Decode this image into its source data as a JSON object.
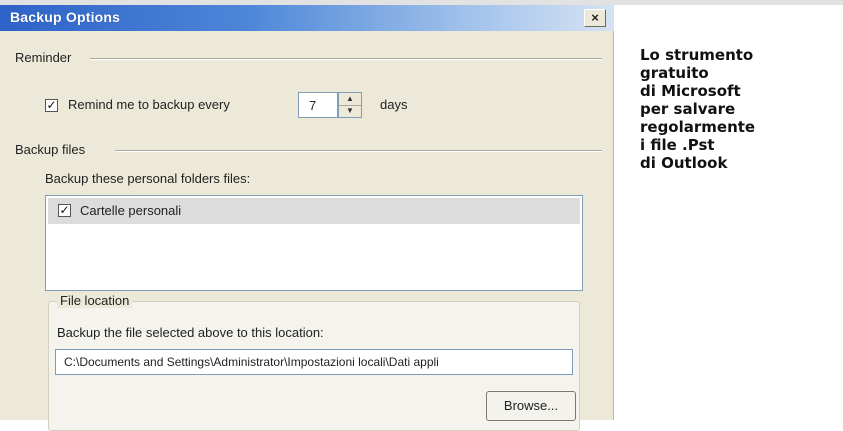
{
  "window": {
    "title": "Backup Options",
    "close_glyph": "×",
    "icons": {
      "close": "close-icon",
      "check": "checkmark-icon",
      "spin_up": "arrow-up-icon",
      "spin_down": "arrow-down-icon"
    }
  },
  "reminder": {
    "group_label": "Reminder",
    "checkbox_checked": true,
    "check_glyph": "✓",
    "label": "Remind me to backup every",
    "interval_value": "7",
    "spin_up": "▲",
    "spin_down": "▼",
    "unit": "days"
  },
  "backup_files": {
    "group_label": "Backup files",
    "list_label": "Backup these personal folders files:",
    "items": [
      {
        "label": "Cartelle personali",
        "checked": true,
        "check_glyph": "✓"
      }
    ]
  },
  "file_location": {
    "group_label": "File location",
    "description": "Backup the file selected above to this location:",
    "path": "C:\\Documents and Settings\\Administrator\\Impostazioni locali\\Dati appli",
    "browse_label": "Browse..."
  },
  "caption": {
    "lines": [
      "Lo strumento",
      "gratuito",
      "di Microsoft",
      "per salvare",
      "regolarmente",
      "i file .Pst",
      "di Outlook"
    ]
  },
  "colors": {
    "titlebar_start": "#2d63c8",
    "titlebar_end": "#d6e3f3",
    "dialog_background": "#ece9d8",
    "list_selection": "#dcdcdc",
    "caption_text": "#111111"
  }
}
